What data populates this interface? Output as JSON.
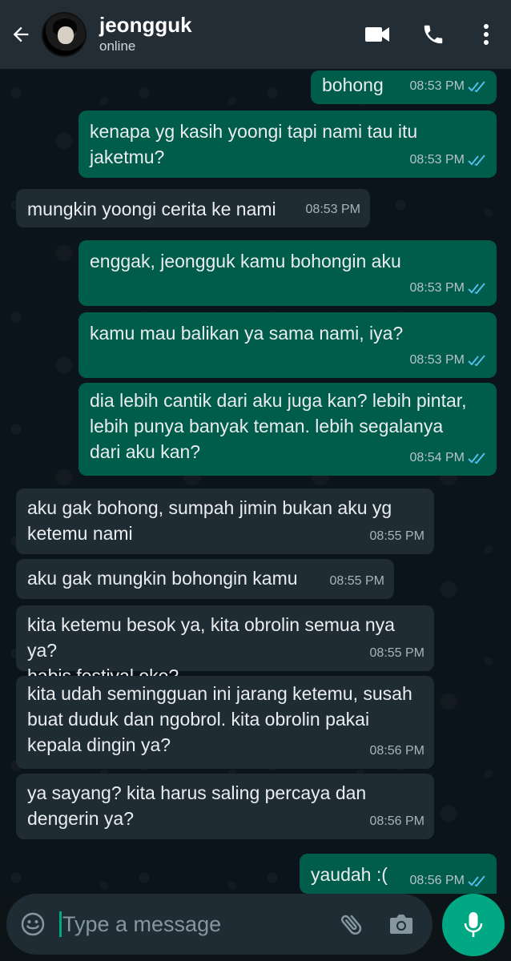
{
  "header": {
    "contact_name": "jeongguk",
    "status": "online"
  },
  "messages": [
    {
      "direction": "out",
      "text": "bohong",
      "time": "08:53 PM",
      "read": true
    },
    {
      "direction": "out",
      "text": "kenapa yg kasih yoongi tapi nami tau itu\njaketmu?",
      "time": "08:53 PM",
      "read": true
    },
    {
      "direction": "in",
      "text": "mungkin yoongi cerita ke nami",
      "time": "08:53 PM"
    },
    {
      "direction": "out",
      "text": "enggak, jeongguk kamu bohongin aku",
      "time": "08:53 PM",
      "read": true
    },
    {
      "direction": "out",
      "text": "kamu mau balikan ya sama nami, iya?",
      "time": "08:53 PM",
      "read": true
    },
    {
      "direction": "out",
      "text": "dia lebih cantik dari aku juga kan? lebih pintar,\nlebih punya banyak teman. lebih segalanya\ndari aku kan?",
      "time": "08:54 PM",
      "read": true
    },
    {
      "direction": "in",
      "text": "aku gak bohong, sumpah jimin bukan aku yg\nketemu nami",
      "time": "08:55 PM"
    },
    {
      "direction": "in",
      "text": "aku gak mungkin bohongin kamu",
      "time": "08:55 PM"
    },
    {
      "direction": "in",
      "text": "kita ketemu besok ya, kita obrolin semua nya ya?\nhabis festival oke?",
      "time": "08:55 PM"
    },
    {
      "direction": "in",
      "text": "kita udah semingguan ini jarang ketemu, susah\nbuat duduk dan ngobrol. kita obrolin pakai\nkepala dingin ya?",
      "time": "08:56 PM"
    },
    {
      "direction": "in",
      "text": "ya sayang? kita harus saling percaya dan\ndengerin ya?",
      "time": "08:56 PM"
    },
    {
      "direction": "out",
      "text": "yaudah :(",
      "time": "08:56 PM",
      "read": true
    }
  ],
  "composer": {
    "placeholder": "Type a message"
  },
  "colors": {
    "outgoing_bubble": "#005c4b",
    "incoming_bubble": "#202c33",
    "header": "#232d36",
    "accent": "#00a884",
    "read_ticks": "#53bdeb"
  },
  "icons": {
    "back": "arrow-left-icon",
    "video": "video-camera-icon",
    "call": "phone-icon",
    "menu": "more-vertical-icon",
    "emoji": "emoji-icon",
    "attach": "paperclip-icon",
    "camera": "camera-icon",
    "mic": "microphone-icon"
  }
}
